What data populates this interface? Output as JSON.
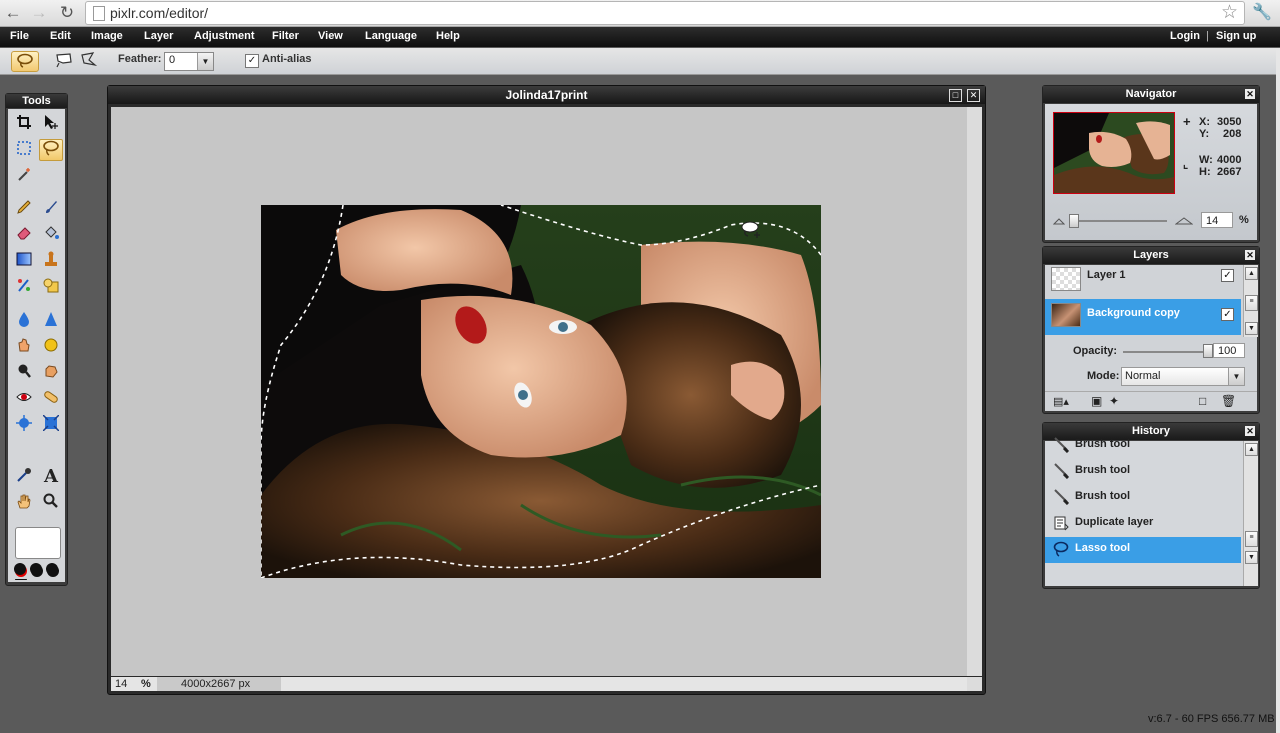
{
  "browser": {
    "url": "pixlr.com/editor/",
    "back_icon": "back-arrow-icon",
    "forward_icon": "forward-arrow-icon",
    "reload_icon": "reload-icon"
  },
  "menu": {
    "items": [
      "File",
      "Edit",
      "Image",
      "Layer",
      "Adjustment",
      "Filter",
      "View",
      "Language",
      "Help"
    ],
    "login": "Login",
    "separator": "|",
    "signup": "Sign up"
  },
  "options": {
    "feather_label": "Feather:",
    "feather_value": "0",
    "antialias_label": "Anti-alias",
    "antialias_checked": true
  },
  "tools": {
    "title": "Tools",
    "active_tool": "lasso",
    "foreground_color": "#ffffff",
    "swatch_colors": [
      "#e00000",
      "#111111",
      "#111111",
      "#111111",
      "#111111",
      "#111111"
    ],
    "text_tool_glyph": "A"
  },
  "document": {
    "title": "Jolinda17print",
    "zoom": "14",
    "zoom_unit": "%",
    "dimensions": "4000x2667 px"
  },
  "navigator": {
    "title": "Navigator",
    "x_label": "X:",
    "x_value": "3050",
    "y_label": "Y:",
    "y_value": "208",
    "w_label": "W:",
    "w_value": "4000",
    "h_label": "H:",
    "h_value": "2667",
    "zoom_value": "14",
    "zoom_unit": "%"
  },
  "layers": {
    "title": "Layers",
    "items": [
      {
        "name": "Layer 1",
        "visible": true,
        "selected": false
      },
      {
        "name": "Background copy",
        "visible": true,
        "selected": true
      }
    ],
    "opacity_label": "Opacity:",
    "opacity_value": "100",
    "mode_label": "Mode:",
    "mode_value": "Normal"
  },
  "history": {
    "title": "History",
    "items": [
      {
        "label": "Brush tool",
        "icon": "brush-icon",
        "selected": false
      },
      {
        "label": "Brush tool",
        "icon": "brush-icon",
        "selected": false
      },
      {
        "label": "Brush tool",
        "icon": "brush-icon",
        "selected": false
      },
      {
        "label": "Duplicate layer",
        "icon": "duplicate-layer-icon",
        "selected": false
      },
      {
        "label": "Lasso tool",
        "icon": "lasso-icon",
        "selected": true
      }
    ]
  },
  "status": {
    "version": "v:6.7 - 60 FPS 656.77 MB"
  },
  "colors": {
    "selection_blue": "#3aa0e8",
    "menubar": "#1a1a1a",
    "canvas_bg": "#c6c6c6"
  }
}
